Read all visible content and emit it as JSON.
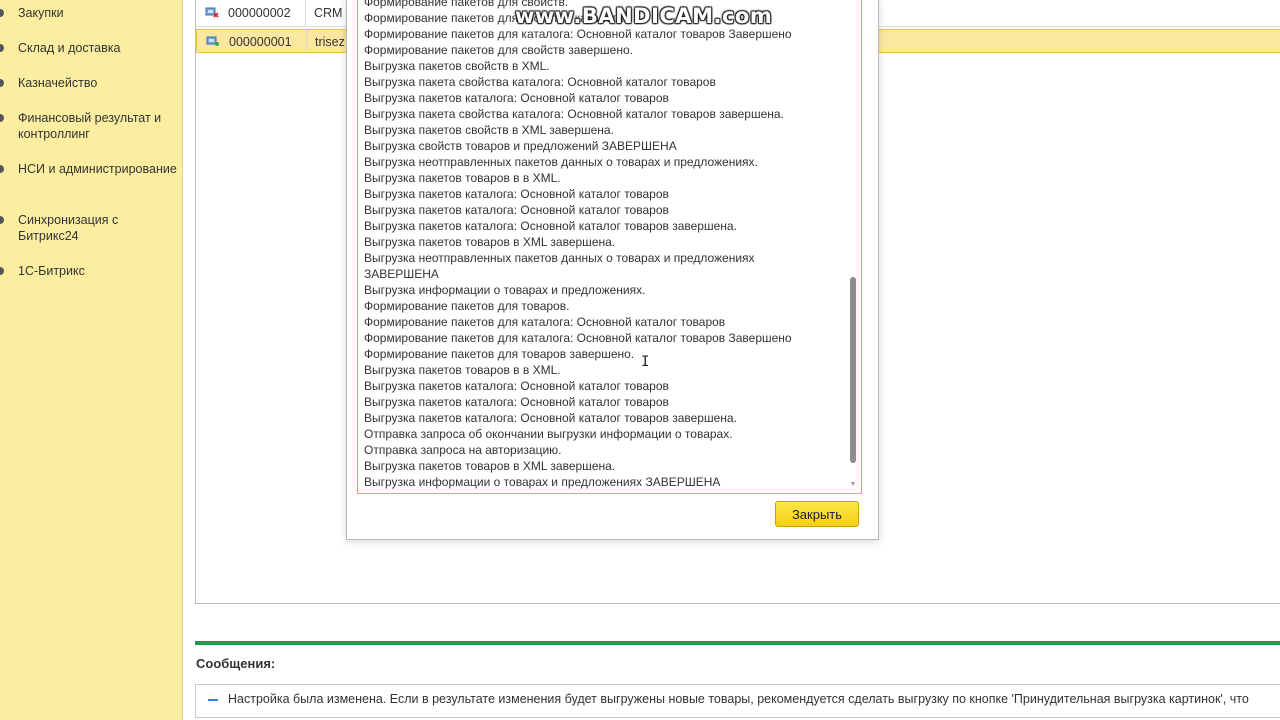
{
  "sidebar": {
    "items": [
      {
        "label": "Закупки"
      },
      {
        "label": "Склад и доставка"
      },
      {
        "label": "Казначейство"
      },
      {
        "label": "Финансовый результат и контроллинг"
      },
      {
        "label": "НСИ и администрирование"
      },
      {
        "label": "Синхронизация с Битрикс24"
      },
      {
        "label": "1С-Битрикс"
      }
    ]
  },
  "list": {
    "rows": [
      {
        "number": "000000002",
        "name": "CRM"
      },
      {
        "number": "000000001",
        "name": "trisez"
      }
    ]
  },
  "dialog": {
    "log_lines": [
      "Формирование пакетов для свойств.",
      "Формирование пакетов для свойства каталога: ",
      "Формирование пакетов для каталога: Основной каталог товаров Завершено",
      "Формирование пакетов для свойств завершено.",
      "Выгрузка пакетов свойств в XML.",
      "Выгрузка пакета свойства каталога: Основной каталог товаров",
      "Выгрузка пакетов каталога: Основной каталог товаров",
      "Выгрузка пакета свойства каталога: Основной каталог товаров завершена.",
      "Выгрузка пакетов свойств в XML завершена.",
      "Выгрузка свойств товаров и предложений ЗАВЕРШЕНА",
      "Выгрузка неотправленных пакетов данных о товарах и предложениях.",
      "Выгрузка пакетов товаров в в XML.",
      "Выгрузка пакетов каталога: Основной каталог товаров",
      "Выгрузка пакетов каталога: Основной каталог товаров",
      "Выгрузка пакетов каталога: Основной каталог товаров завершена.",
      "Выгрузка пакетов товаров в XML завершена.",
      "Выгрузка неотправленных пакетов данных  о товарах и предложениях",
      "ЗАВЕРШЕНА",
      "Выгрузка информации  о товарах и предложениях.",
      "Формирование пакетов для товаров.",
      "Формирование пакетов для каталога: Основной каталог товаров",
      "Формирование пакетов для каталога: Основной каталог товаров Завершено",
      "Формирование пакетов для товаров завершено.",
      "Выгрузка пакетов товаров в в XML.",
      "Выгрузка пакетов каталога: Основной каталог товаров",
      "Выгрузка пакетов каталога: Основной каталог товаров",
      "Выгрузка пакетов каталога: Основной каталог товаров завершена.",
      "Отправка запроса об окончании выгрузки информации о товарах.",
      "Отправка запроса на авторизацию.",
      "Выгрузка пакетов товаров в XML завершена.",
      "Выгрузка информации  о товарах и предложениях ЗАВЕРШЕНА"
    ],
    "close_label": "Закрыть"
  },
  "watermark": "www.BANDICAM.com",
  "messages": {
    "title": "Сообщения:",
    "items": [
      {
        "text": "Настройка была изменена. Если в результате изменения будет выгружены новые товары, рекомендуется сделать выгрузку по кнопке 'Принудительная выгрузка картинок', что"
      }
    ]
  },
  "colors": {
    "sidebar_bg": "#fbeea1",
    "selected_row": "#fbe7a0",
    "accent_yellow": "#f5cf10",
    "messages_bar": "#1c9c4c"
  }
}
